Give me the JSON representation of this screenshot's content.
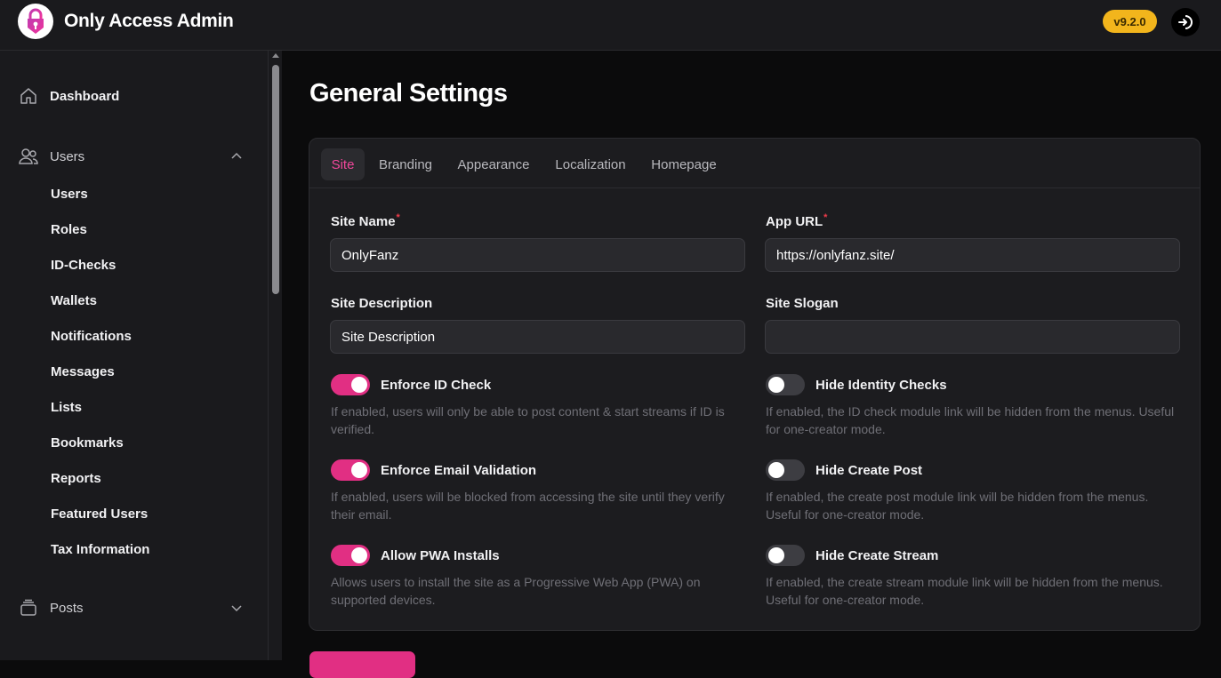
{
  "header": {
    "app_title": "Only Access Admin",
    "version": "v9.2.0",
    "logo_icon": "padlock-logo-icon",
    "logout_icon": "logout-icon"
  },
  "sidebar": {
    "dashboard": "Dashboard",
    "users_group": "Users",
    "users_items": [
      "Users",
      "Roles",
      "ID-Checks",
      "Wallets",
      "Notifications",
      "Messages",
      "Lists",
      "Bookmarks",
      "Reports",
      "Featured Users",
      "Tax Information"
    ],
    "posts_group": "Posts"
  },
  "main": {
    "page_title": "General Settings",
    "tabs": [
      "Site",
      "Branding",
      "Appearance",
      "Localization",
      "Homepage"
    ],
    "active_tab": "Site",
    "fields": {
      "site_name_label": "Site Name",
      "site_name_value": "OnlyFanz",
      "app_url_label": "App URL",
      "app_url_value": "https://onlyfanz.site/",
      "required_mark": "*",
      "site_description_label": "Site Description",
      "site_description_placeholder": "Site Description",
      "site_slogan_label": "Site Slogan",
      "site_slogan_value": ""
    },
    "toggles": {
      "enforce_id": {
        "label": "Enforce ID Check",
        "on": true,
        "help": "If enabled, users will only be able to post content & start streams if ID is verified."
      },
      "hide_identity": {
        "label": "Hide Identity Checks",
        "on": false,
        "help": "If enabled, the ID check module link will be hidden from the menus. Useful for one-creator mode."
      },
      "enforce_email": {
        "label": "Enforce Email Validation",
        "on": true,
        "help": "If enabled, users will be blocked from accessing the site until they verify their email."
      },
      "hide_post": {
        "label": "Hide Create Post",
        "on": false,
        "help": "If enabled, the create post module link will be hidden from the menus. Useful for one-creator mode."
      },
      "allow_pwa": {
        "label": "Allow PWA Installs",
        "on": true,
        "help": "Allows users to install the site as a Progressive Web App (PWA) on supported devices."
      },
      "hide_stream": {
        "label": "Hide Create Stream",
        "on": false,
        "help": "If enabled, the create stream module link will be hidden from the menus. Useful for one-creator mode."
      }
    }
  },
  "colors": {
    "accent": "#e12f83",
    "tab_active_text": "#f0479a",
    "badge": "#f2b51c"
  }
}
